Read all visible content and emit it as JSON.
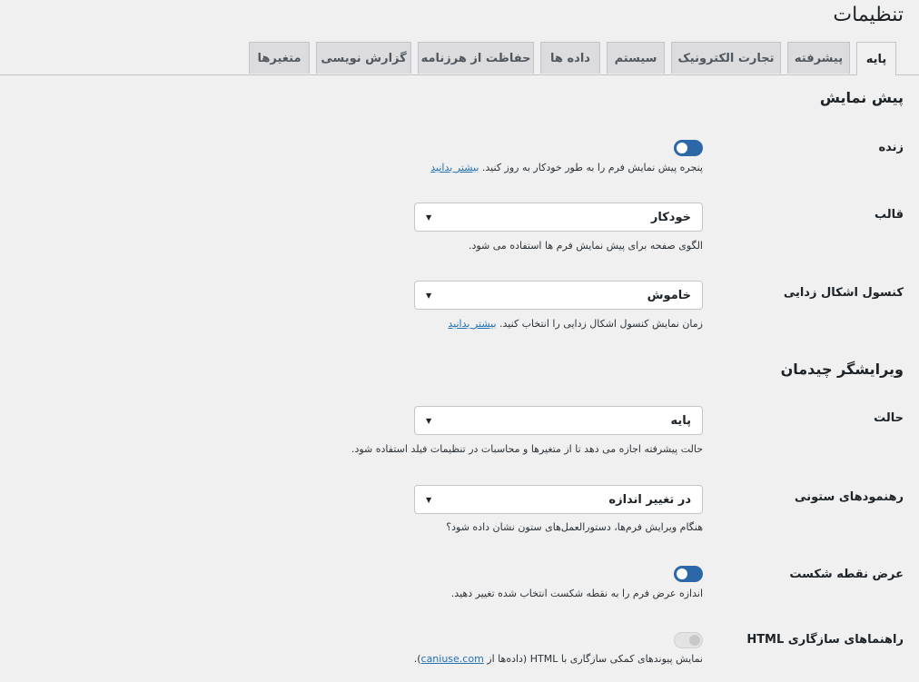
{
  "page": {
    "title": "تنظیمات"
  },
  "tabs": [
    {
      "label": "پایه",
      "active": true
    },
    {
      "label": "پیشرفته"
    },
    {
      "label": "تجارت الکترونیک"
    },
    {
      "label": "سیستم"
    },
    {
      "label": "داده ها"
    },
    {
      "label": "حفاظت از هرزنامه"
    },
    {
      "label": "گزارش نویسی"
    },
    {
      "label": "متغیرها"
    }
  ],
  "sections": {
    "preview": {
      "title": "پیش نمایش",
      "live": {
        "label": "زنده",
        "toggle_state": "on",
        "desc": "پنجره پیش نمایش فرم را به طور خودکار به روز کنید.",
        "link": "بیشتر بدانید"
      },
      "template": {
        "label": "قالب",
        "value": "خودکار",
        "desc": "الگوی صفحه برای پیش نمایش فرم ها استفاده می شود."
      },
      "debug_console": {
        "label": "کنسول اشکال زدایی",
        "value": "خاموش",
        "desc": "زمان نمایش کنسول اشکال زدایی را انتخاب کنید.",
        "link": "بیشتر بدانید"
      }
    },
    "layout_editor": {
      "title": "ویرایشگر چیدمان",
      "mode": {
        "label": "حالت",
        "value": "پایه",
        "desc": "حالت پیشرفته اجازه می دهد تا از متغیرها و محاسبات در تنظیمات فیلد استفاده شود."
      },
      "column_guides": {
        "label": "رهنمودهای ستونی",
        "value": "در تغییر اندازه",
        "desc": "هنگام ویرایش فرم‌ها، دستورالعمل‌های ستون نشان داده شود؟"
      },
      "breakpoint_width": {
        "label": "عرض نقطه شکست",
        "toggle_state": "on",
        "desc": "اندازه عرض فرم را به نقطه شکست انتخاب شده تغییر دهید."
      },
      "html_compat": {
        "label": "راهنماهای سازگاری HTML",
        "toggle_state": "disabled",
        "desc_before": "نمایش پیوندهای کمکی سازگاری با HTML (داده‌ها از",
        "link": "caniuse.com",
        "desc_after": ")."
      }
    }
  }
}
